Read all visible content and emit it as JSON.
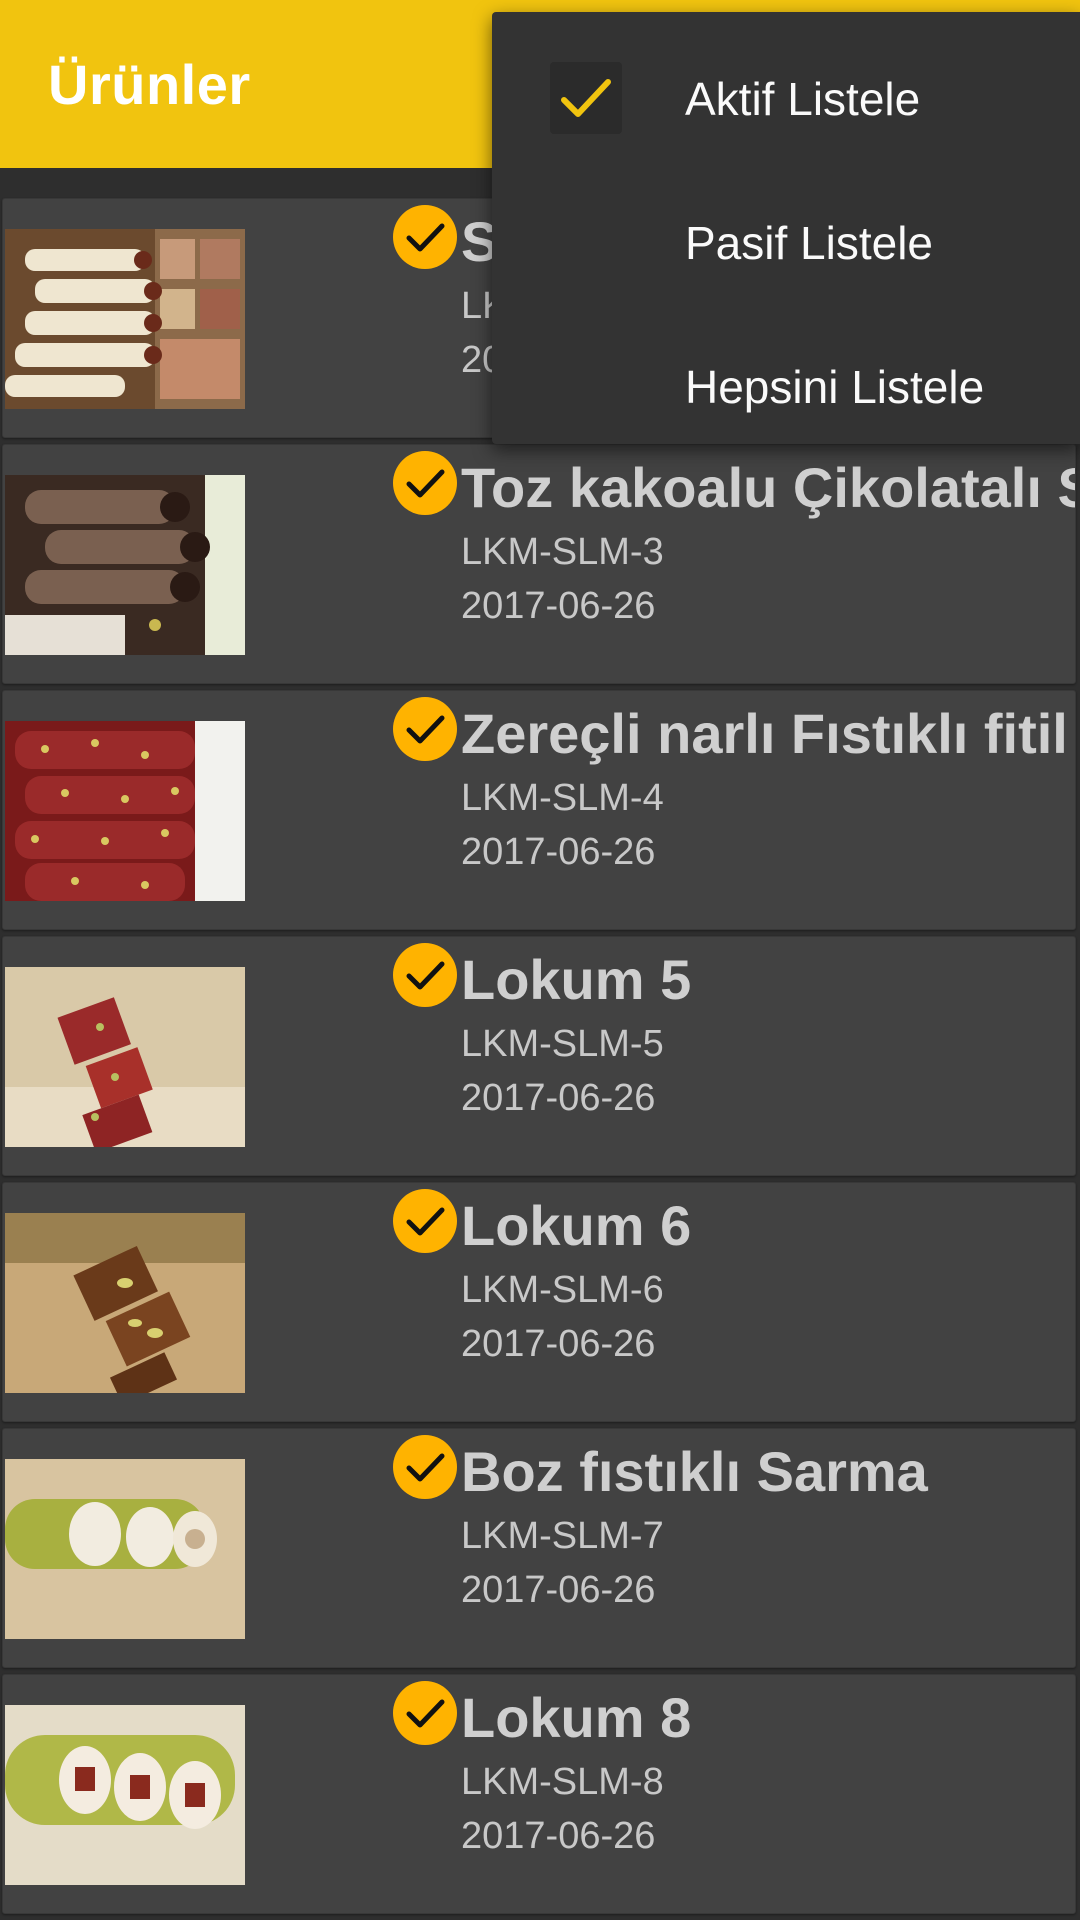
{
  "appbar": {
    "title": "Ürünler",
    "color": "#f1c40f"
  },
  "menu": {
    "items": [
      {
        "label": "Aktif Listele",
        "checked": true
      },
      {
        "label": "Pasif Listele",
        "checked": false
      },
      {
        "label": "Hepsini Listele",
        "checked": false
      }
    ]
  },
  "products": [
    {
      "title": "S",
      "code": "LK",
      "date": "20",
      "active": true,
      "image": "rolled-lokum-photo"
    },
    {
      "title": "Toz kakoalu Çikolatalı S",
      "code": "LKM-SLM-3",
      "date": "2017-06-26",
      "active": true,
      "image": "cocoa-lokum-photo"
    },
    {
      "title": "Zereçli narlı Fıstıklı fitil",
      "code": "LKM-SLM-4",
      "date": "2017-06-26",
      "active": true,
      "image": "pomegranate-lokum-photo"
    },
    {
      "title": "Lokum 5",
      "code": "LKM-SLM-5",
      "date": "2017-06-26",
      "active": true,
      "image": "lokum-5-photo"
    },
    {
      "title": "Lokum 6",
      "code": "LKM-SLM-6",
      "date": "2017-06-26",
      "active": true,
      "image": "lokum-6-photo"
    },
    {
      "title": "Boz fıstıklı Sarma",
      "code": "LKM-SLM-7",
      "date": "2017-06-26",
      "active": true,
      "image": "pistachio-roll-photo"
    },
    {
      "title": "Lokum 8",
      "code": "LKM-SLM-8",
      "date": "2017-06-26",
      "active": true,
      "image": "lokum-8-photo"
    }
  ],
  "colors": {
    "check_badge": "#ffb300",
    "card_bg": "#424242",
    "menu_bg": "#333333",
    "menu_check": "#f1c40f"
  }
}
